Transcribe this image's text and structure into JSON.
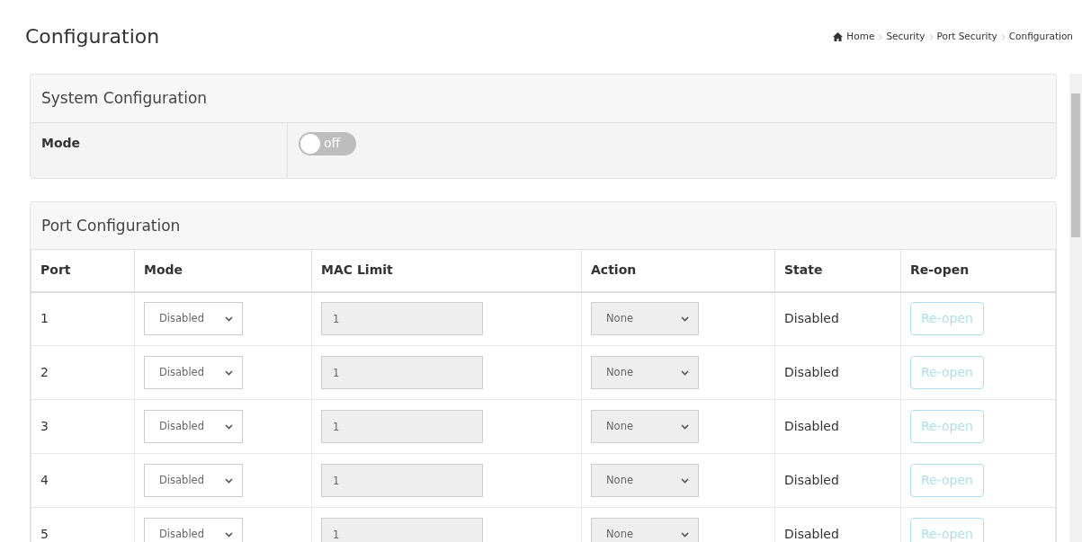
{
  "page_title": "Configuration",
  "breadcrumb": [
    "Home",
    "Security",
    "Port Security",
    "Configuration"
  ],
  "system_configuration": {
    "title": "System Configuration",
    "mode": {
      "label": "Mode",
      "on": false,
      "switch_text": "off"
    }
  },
  "port_configuration": {
    "title": "Port Configuration",
    "columns": [
      "Port",
      "Mode",
      "MAC Limit",
      "Action",
      "State",
      "Re-open"
    ],
    "rows": [
      {
        "port": "1",
        "mode": "Disabled",
        "mac_limit": "1",
        "mac_limit_disabled": true,
        "action": "None",
        "action_disabled": true,
        "state": "Disabled",
        "reopen": "Re-open",
        "reopen_disabled": true
      },
      {
        "port": "2",
        "mode": "Disabled",
        "mac_limit": "1",
        "mac_limit_disabled": true,
        "action": "None",
        "action_disabled": true,
        "state": "Disabled",
        "reopen": "Re-open",
        "reopen_disabled": true
      },
      {
        "port": "3",
        "mode": "Disabled",
        "mac_limit": "1",
        "mac_limit_disabled": true,
        "action": "None",
        "action_disabled": true,
        "state": "Disabled",
        "reopen": "Re-open",
        "reopen_disabled": true
      },
      {
        "port": "4",
        "mode": "Disabled",
        "mac_limit": "1",
        "mac_limit_disabled": true,
        "action": "None",
        "action_disabled": true,
        "state": "Disabled",
        "reopen": "Re-open",
        "reopen_disabled": true
      },
      {
        "port": "5",
        "mode": "Disabled",
        "mac_limit": "1",
        "mac_limit_disabled": true,
        "action": "None",
        "action_disabled": true,
        "state": "Disabled",
        "reopen": "Re-open",
        "reopen_disabled": true
      }
    ]
  }
}
